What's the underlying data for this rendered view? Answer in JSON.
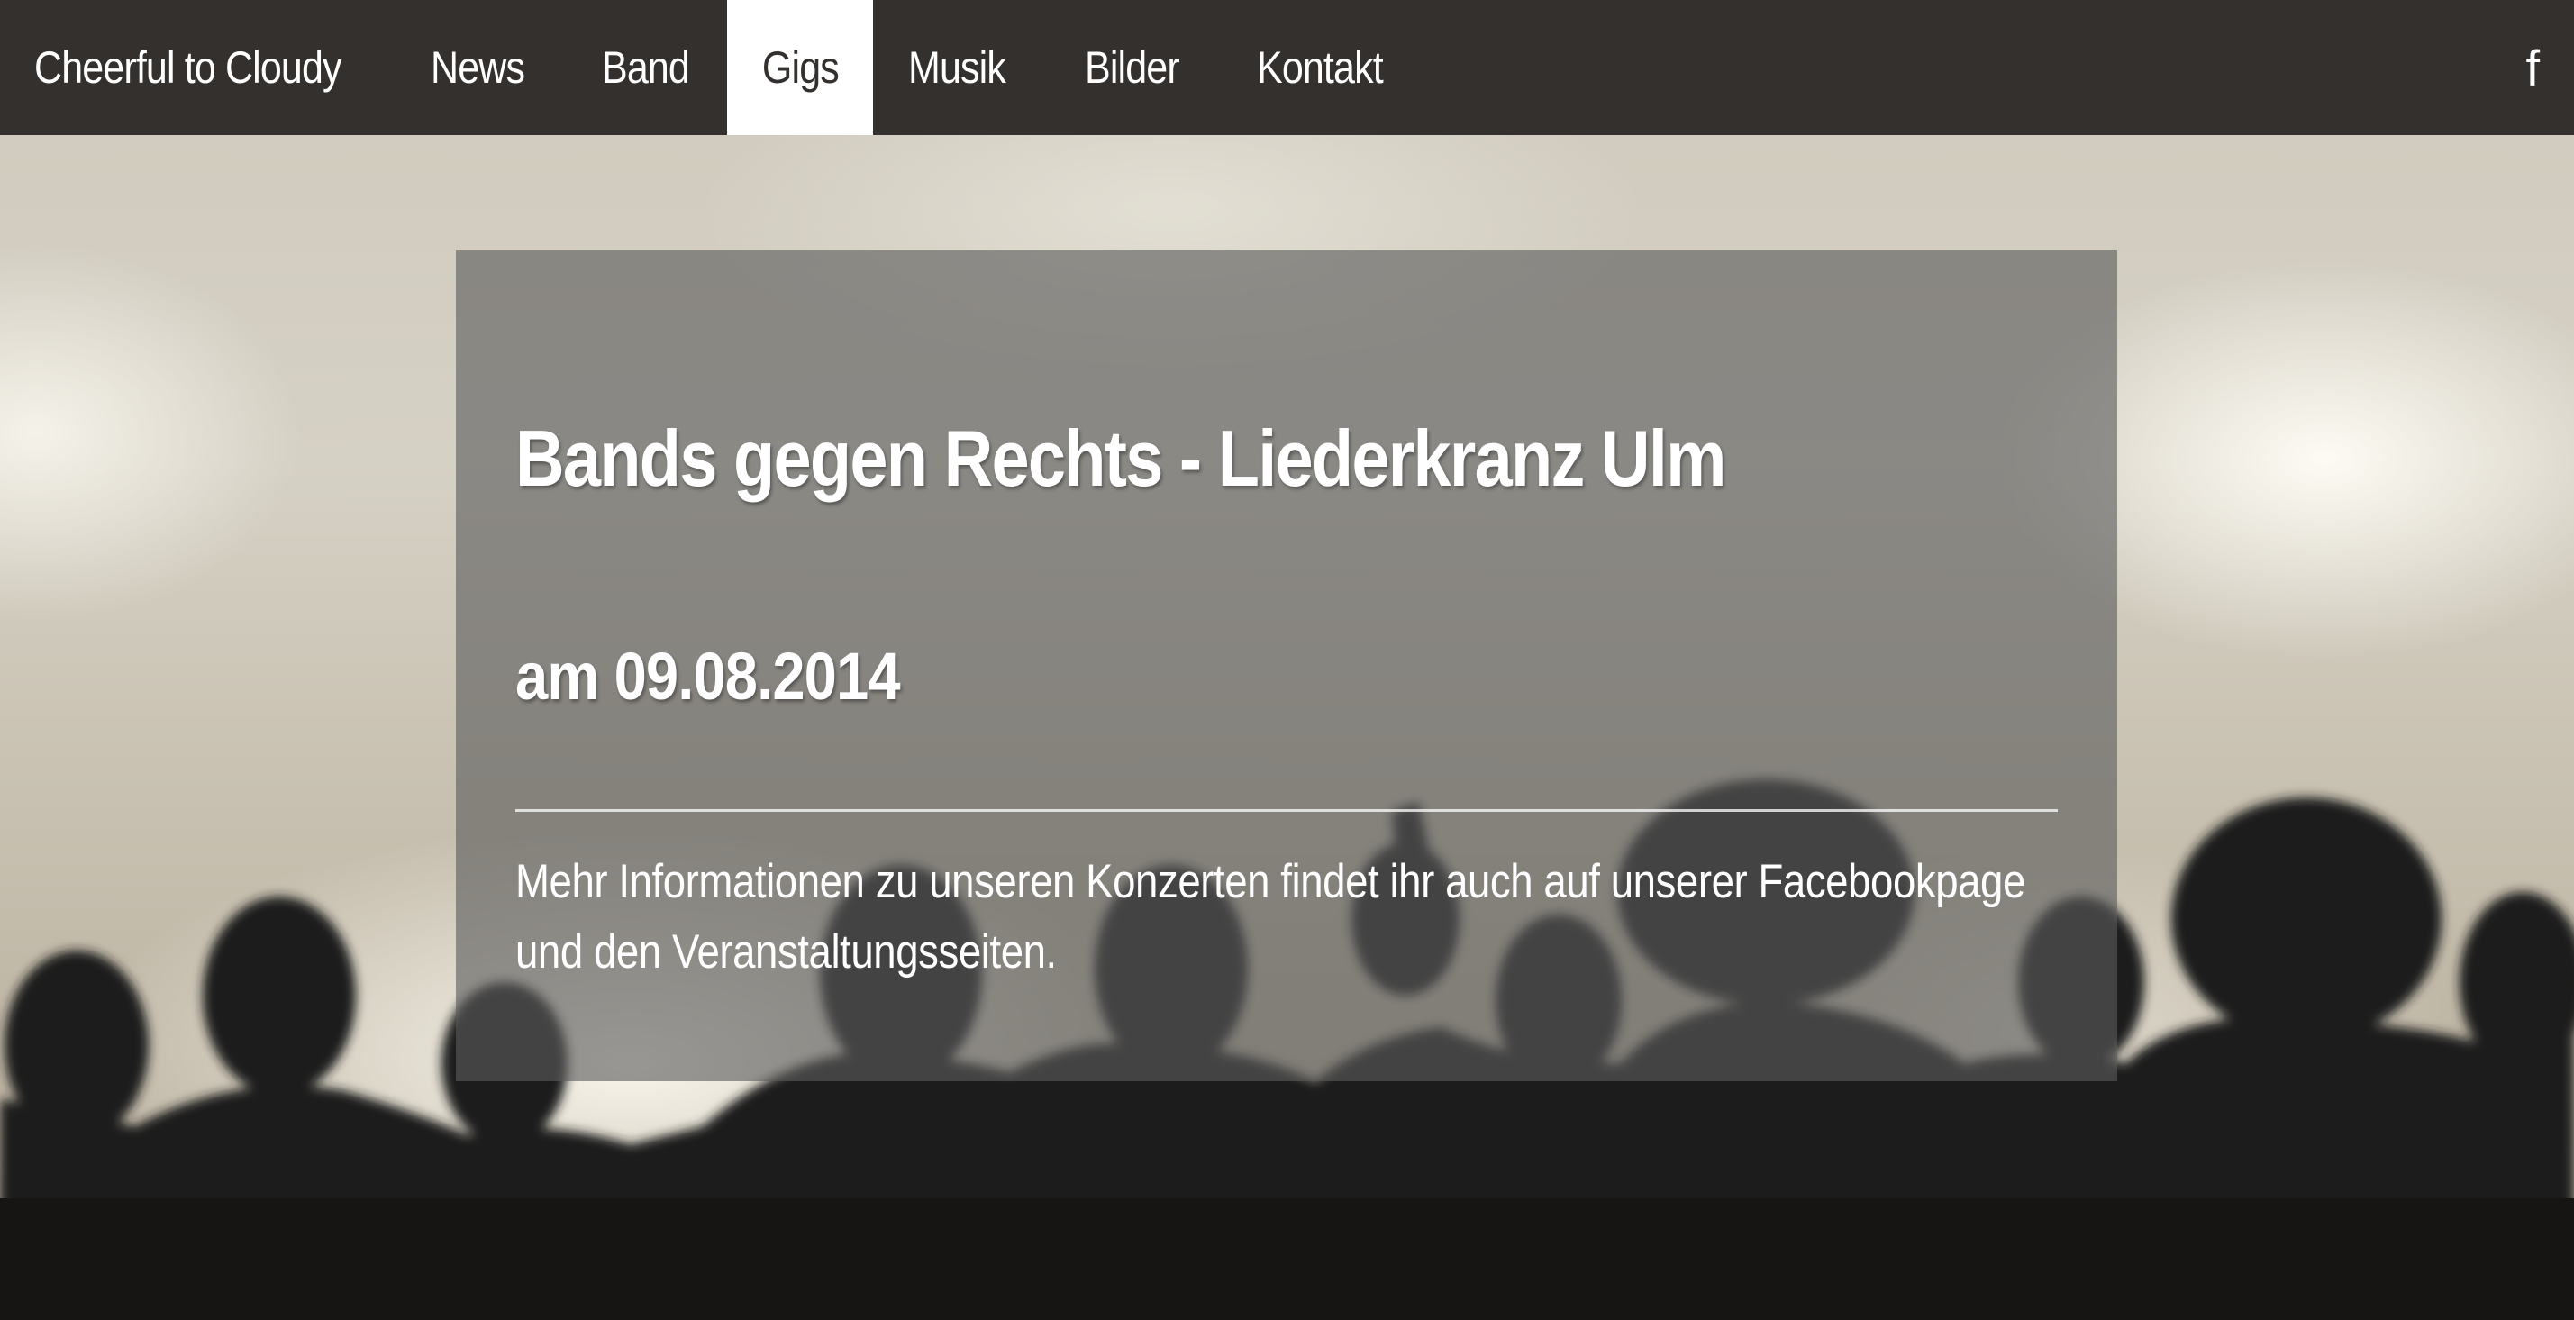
{
  "nav": {
    "brand": "Cheerful to Cloudy",
    "items": [
      {
        "label": "News"
      },
      {
        "label": "Band"
      },
      {
        "label": "Gigs",
        "active": true
      },
      {
        "label": "Musik"
      },
      {
        "label": "Bilder"
      },
      {
        "label": "Kontakt"
      }
    ],
    "social_label": "f",
    "social_icon": "facebook-icon"
  },
  "event": {
    "title": "Bands gegen Rechts - Liederkranz Ulm",
    "date": "am 09.08.2014"
  },
  "info": {
    "text": "Mehr Informationen zu unseren Konzerten findet ihr auch auf unserer Facebookpage und den Veranstaltungsseiten."
  },
  "colors": {
    "navbar_bg": "#33302e",
    "active_tab_bg": "#ffffff",
    "card_bg": "rgba(92,92,92,0.62)",
    "text": "#ffffff"
  }
}
